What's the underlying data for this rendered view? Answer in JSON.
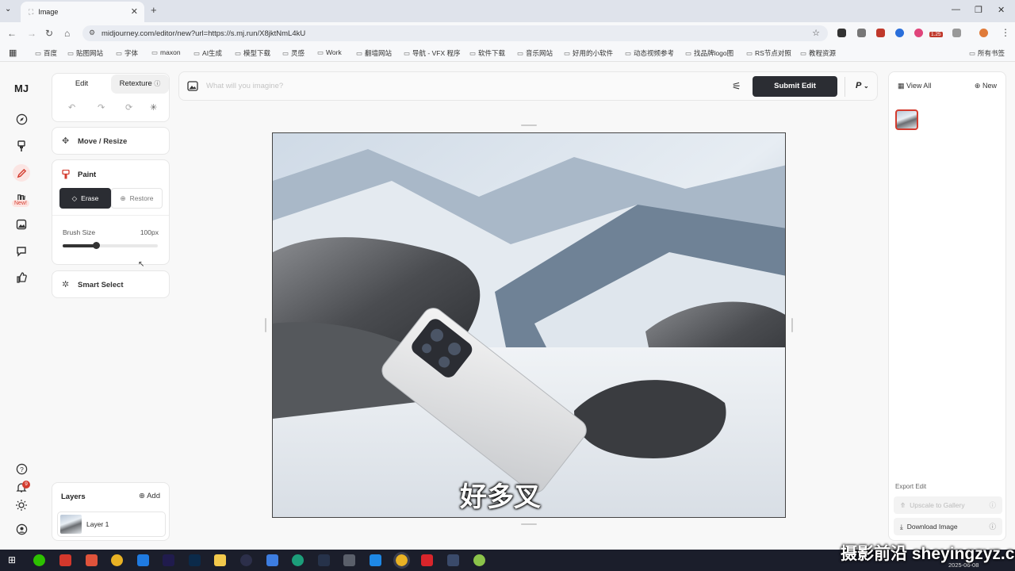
{
  "browser": {
    "tab_title": "Image",
    "url": "midjourney.com/editor/new?url=https://s.mj.run/X8jktNmL4kU",
    "extension_badge": "1.25",
    "bookmarks": [
      "百度",
      "贴图网站",
      "字体",
      "maxon",
      "AI生成",
      "模型下载",
      "灵感",
      "Work",
      "翻墙网站",
      "导航 - VFX 程序",
      "软件下载",
      "音乐网站",
      "好用的小软件",
      "动态视频参考",
      "找品牌logo图",
      "RS节点对照",
      "教程资源"
    ],
    "all_bookmarks": "所有书签"
  },
  "app": {
    "logo": "MJ",
    "new_badge": "New!",
    "notification_count": "9",
    "tabs": {
      "edit": "Edit",
      "retexture": "Retexture"
    },
    "tools": {
      "move_resize": "Move / Resize",
      "paint": "Paint",
      "erase": "Erase",
      "restore": "Restore",
      "brush_size_label": "Brush Size",
      "brush_size_value": "100px",
      "brush_level": 0.35,
      "smart_select": "Smart Select"
    },
    "layers": {
      "title": "Layers",
      "add": "Add",
      "items": [
        "Layer 1"
      ]
    },
    "prompt": {
      "placeholder": "What will you imagine?",
      "submit": "Submit Edit",
      "mode": "P"
    },
    "right": {
      "view_all": "View All",
      "new": "New",
      "export_title": "Export Edit",
      "upscale": "Upscale to Gallery",
      "download": "Download Image"
    },
    "subtitle": "好多叉"
  },
  "taskbar": {
    "date": "2025-06-08"
  },
  "watermark": "摄影前沿 sheyingzyz.com",
  "colors": {
    "accent": "#d33c2f",
    "dark": "#2b2d33"
  }
}
